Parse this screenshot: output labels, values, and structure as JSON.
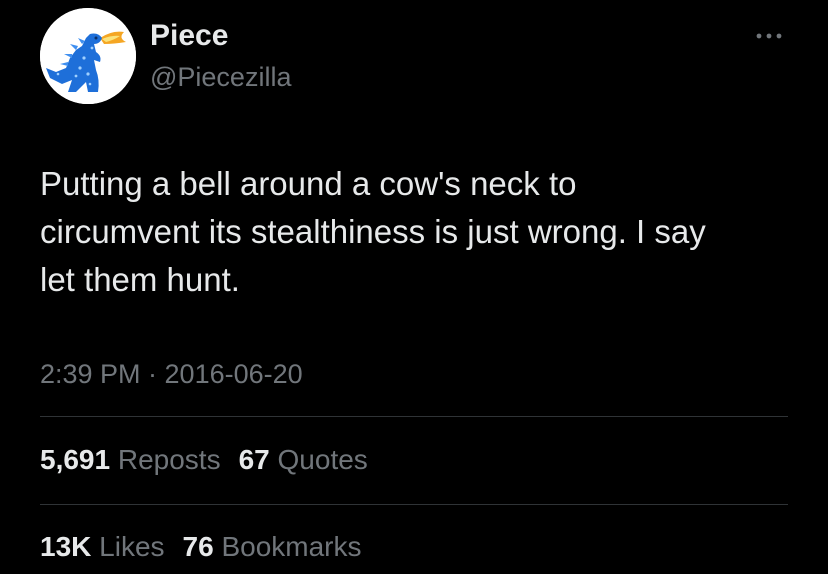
{
  "user": {
    "display_name": "Piece",
    "handle": "@Piecezilla",
    "avatar_icon": "godzilla-avatar-icon"
  },
  "tweet": {
    "text": "Putting a bell around a cow's neck to\ncircumvent its stealthiness is just wrong. I say\nlet them hunt.",
    "timestamp": "2:39 PM · 2016-06-20"
  },
  "stats": {
    "reposts_count": "5,691",
    "reposts_label": "Reposts",
    "quotes_count": "67",
    "quotes_label": "Quotes",
    "likes_count": "13K",
    "likes_label": "Likes",
    "bookmarks_count": "76",
    "bookmarks_label": "Bookmarks"
  },
  "colors": {
    "background": "#000000",
    "primary_text": "#e7e9ea",
    "secondary_text": "#71767b",
    "divider": "#2f3336",
    "avatar_blue": "#1e6fd9",
    "fire_orange": "#f5a623"
  }
}
